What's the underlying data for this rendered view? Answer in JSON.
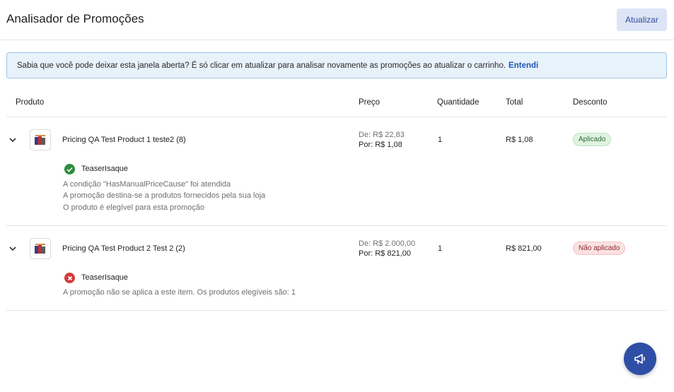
{
  "header": {
    "title": "Analisador de Promoções",
    "refresh_label": "Atualizar"
  },
  "info": {
    "text": "Sabia que você pode deixar esta janela aberta? É só clicar em atualizar para analisar novamente as promoções ao atualizar o carrinho.",
    "link": "Entendi",
    "bg_color": "#e8f2fb"
  },
  "table": {
    "columns": [
      "Produto",
      "Preço",
      "Quantidade",
      "Total",
      "Desconto"
    ],
    "rows": [
      {
        "product": "Pricing QA Test Product 1 teste2 (8)",
        "price_de": "De: R$ 22,83",
        "price_por": "Por: R$ 1,08",
        "quantity": "1",
        "total": "R$ 1,08",
        "discount": "Aplicado",
        "promo_status_icon": "check-circle-icon",
        "promo_name": "TeaserIsaque",
        "details": [
          "A condição \"HasManualPriceCause\" foi atendida",
          "A promoção destina-se a produtos fornecidos pela sua loja",
          "O produto é elegível para esta promoção"
        ]
      },
      {
        "product": "Pricing QA Test Product 2 Test 2 (2)",
        "price_de": "De: R$ 2.000,00",
        "price_por": "Por: R$ 821,00",
        "quantity": "1",
        "total": "R$ 821,00",
        "discount": "Não aplicado",
        "promo_status_icon": "x-circle-icon",
        "promo_name": "TeaserIsaque",
        "details": [
          "A promoção não se aplica a este item. Os produtos elegíveis são: 1"
        ]
      }
    ]
  },
  "fab": {
    "icon": "megaphone-icon",
    "color": "#2f4ea6"
  },
  "colors": {
    "applied": "#2e8b3d",
    "not_applied": "#d23b3b",
    "accent": "#2157b7"
  }
}
